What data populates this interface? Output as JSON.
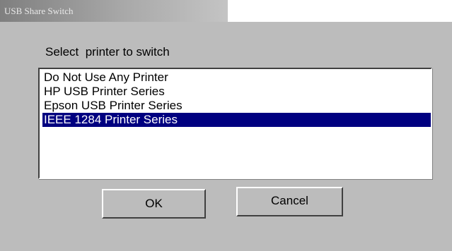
{
  "window": {
    "title": "USB Share Switch"
  },
  "dialog": {
    "prompt": "Select  printer to switch",
    "printers": [
      {
        "label": "Do Not Use Any Printer",
        "selected": false
      },
      {
        "label": "HP USB Printer Series",
        "selected": false
      },
      {
        "label": "Epson USB Printer Series",
        "selected": false
      },
      {
        "label": "IEEE 1284 Printer Series",
        "selected": true
      }
    ],
    "ok_label": "OK",
    "cancel_label": "Cancel"
  },
  "colors": {
    "dialog_background": "#bcbcbc",
    "selection_background": "#000080",
    "selection_text": "#ffffff"
  }
}
